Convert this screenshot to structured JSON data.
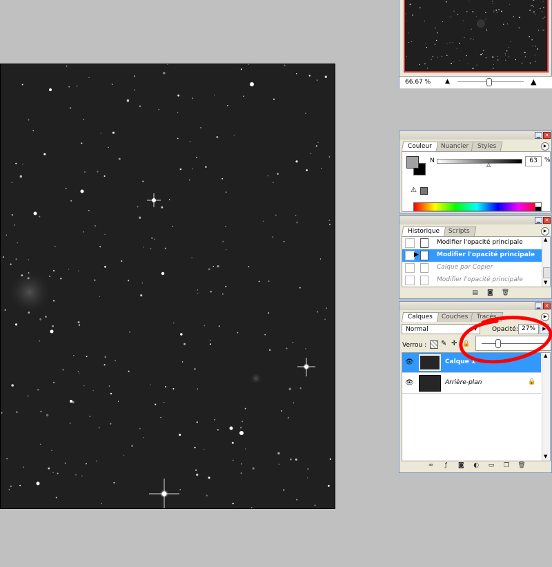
{
  "navigator": {
    "zoom_value": "66.67 %"
  },
  "color_panel": {
    "tabs": [
      "Couleur",
      "Nuancier",
      "Styles"
    ],
    "channel_label": "N",
    "channel_value": "63",
    "channel_unit": "%"
  },
  "history_panel": {
    "tabs": [
      "Historique",
      "Scripts"
    ],
    "items": [
      {
        "label": "Modifier l'opacité principale",
        "state": "normal"
      },
      {
        "label": "Modifier l'opacité principale",
        "state": "selected"
      },
      {
        "label": "Calque par Copier",
        "state": "dimmed"
      },
      {
        "label": "Modifier l'opacité principale",
        "state": "dimmed"
      }
    ]
  },
  "layers_panel": {
    "tabs": [
      "Calques",
      "Couches",
      "Tracés"
    ],
    "blend_mode": "Normal",
    "opacity_label": "Opacité:",
    "opacity_value": "27%",
    "lock_label": "Verrou :",
    "layers": [
      {
        "name": "Calque 1",
        "selected": true
      },
      {
        "name": "Arrière-plan",
        "selected": false,
        "locked": true
      }
    ]
  },
  "colors": {
    "workspace": "#c0c0c0",
    "canvas": "#202020",
    "selection": "#3399ff",
    "annotation": "#ff0000"
  }
}
